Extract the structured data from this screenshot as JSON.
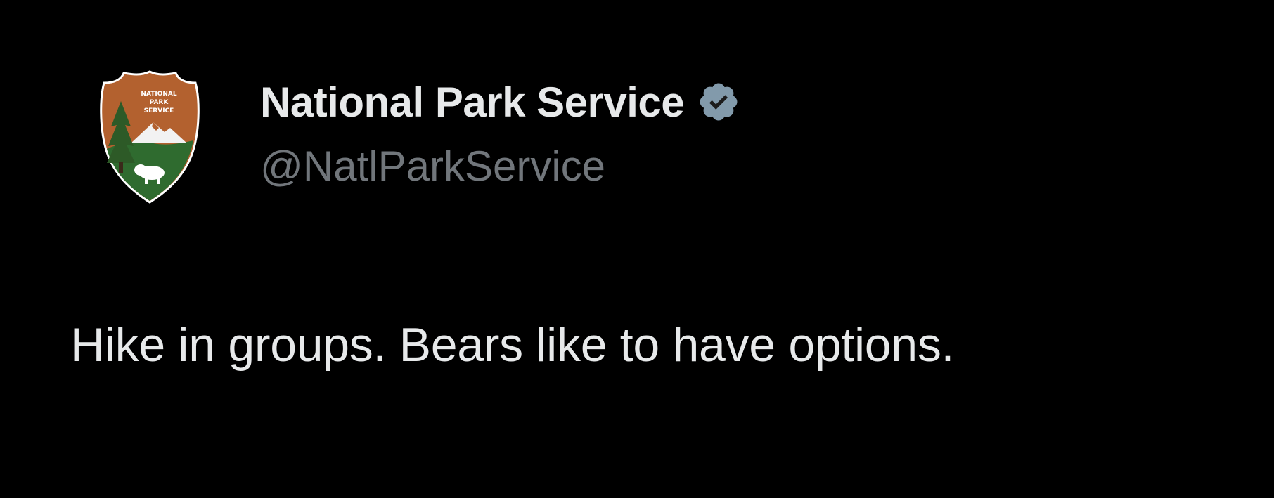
{
  "tweet": {
    "author": {
      "display_name": "National Park Service",
      "handle": "@NatlParkService",
      "verified": true,
      "verified_badge_color": "#829aab",
      "avatar": {
        "icon": "nps-arrowhead-logo",
        "logo_text": "NATIONAL PARK SERVICE",
        "colors": {
          "arrowhead": "#b3612f",
          "land": "#2f6b2f",
          "mountain": "#ffffff",
          "tree": "#2d5a27"
        }
      }
    },
    "text": "Hike in groups. Bears like to have options."
  },
  "theme": {
    "background": "#000000",
    "primary_text": "#e7e9ea",
    "secondary_text": "#71767b"
  }
}
